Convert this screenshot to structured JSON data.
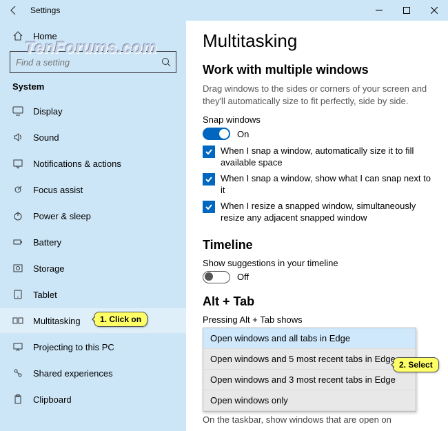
{
  "titlebar": {
    "title": "Settings"
  },
  "watermark": "TenForums.com",
  "sidebar": {
    "home": "Home",
    "search_placeholder": "Find a setting",
    "section": "System",
    "items": [
      {
        "label": "Display",
        "icon": "display"
      },
      {
        "label": "Sound",
        "icon": "sound"
      },
      {
        "label": "Notifications & actions",
        "icon": "notifications"
      },
      {
        "label": "Focus assist",
        "icon": "focus"
      },
      {
        "label": "Power & sleep",
        "icon": "power"
      },
      {
        "label": "Battery",
        "icon": "battery"
      },
      {
        "label": "Storage",
        "icon": "storage"
      },
      {
        "label": "Tablet",
        "icon": "tablet"
      },
      {
        "label": "Multitasking",
        "icon": "multitasking",
        "selected": true
      },
      {
        "label": "Projecting to this PC",
        "icon": "projecting"
      },
      {
        "label": "Shared experiences",
        "icon": "shared"
      },
      {
        "label": "Clipboard",
        "icon": "clipboard"
      }
    ]
  },
  "content": {
    "heading": "Multitasking",
    "snap": {
      "title": "Work with multiple windows",
      "desc": "Drag windows to the sides or corners of your screen and they'll automatically size to fit perfectly, side by side.",
      "label": "Snap windows",
      "toggle_state": "On",
      "checks": [
        "When I snap a window, automatically size it to fill available space",
        "When I snap a window, show what I can snap next to it",
        "When I resize a snapped window, simultaneously resize any adjacent snapped window"
      ]
    },
    "timeline": {
      "title": "Timeline",
      "label": "Show suggestions in your timeline",
      "toggle_state": "Off"
    },
    "alttab": {
      "title": "Alt + Tab",
      "label": "Pressing Alt + Tab shows",
      "options": [
        "Open windows and all tabs in Edge",
        "Open windows and 5 most recent tabs in Edge",
        "Open windows and 3 most recent tabs in Edge",
        "Open windows only"
      ],
      "selected_index": 0
    },
    "cutoff_text": "On the taskbar, show windows that are open on"
  },
  "callouts": {
    "c1": "1. Click on",
    "c2": "2. Select"
  }
}
